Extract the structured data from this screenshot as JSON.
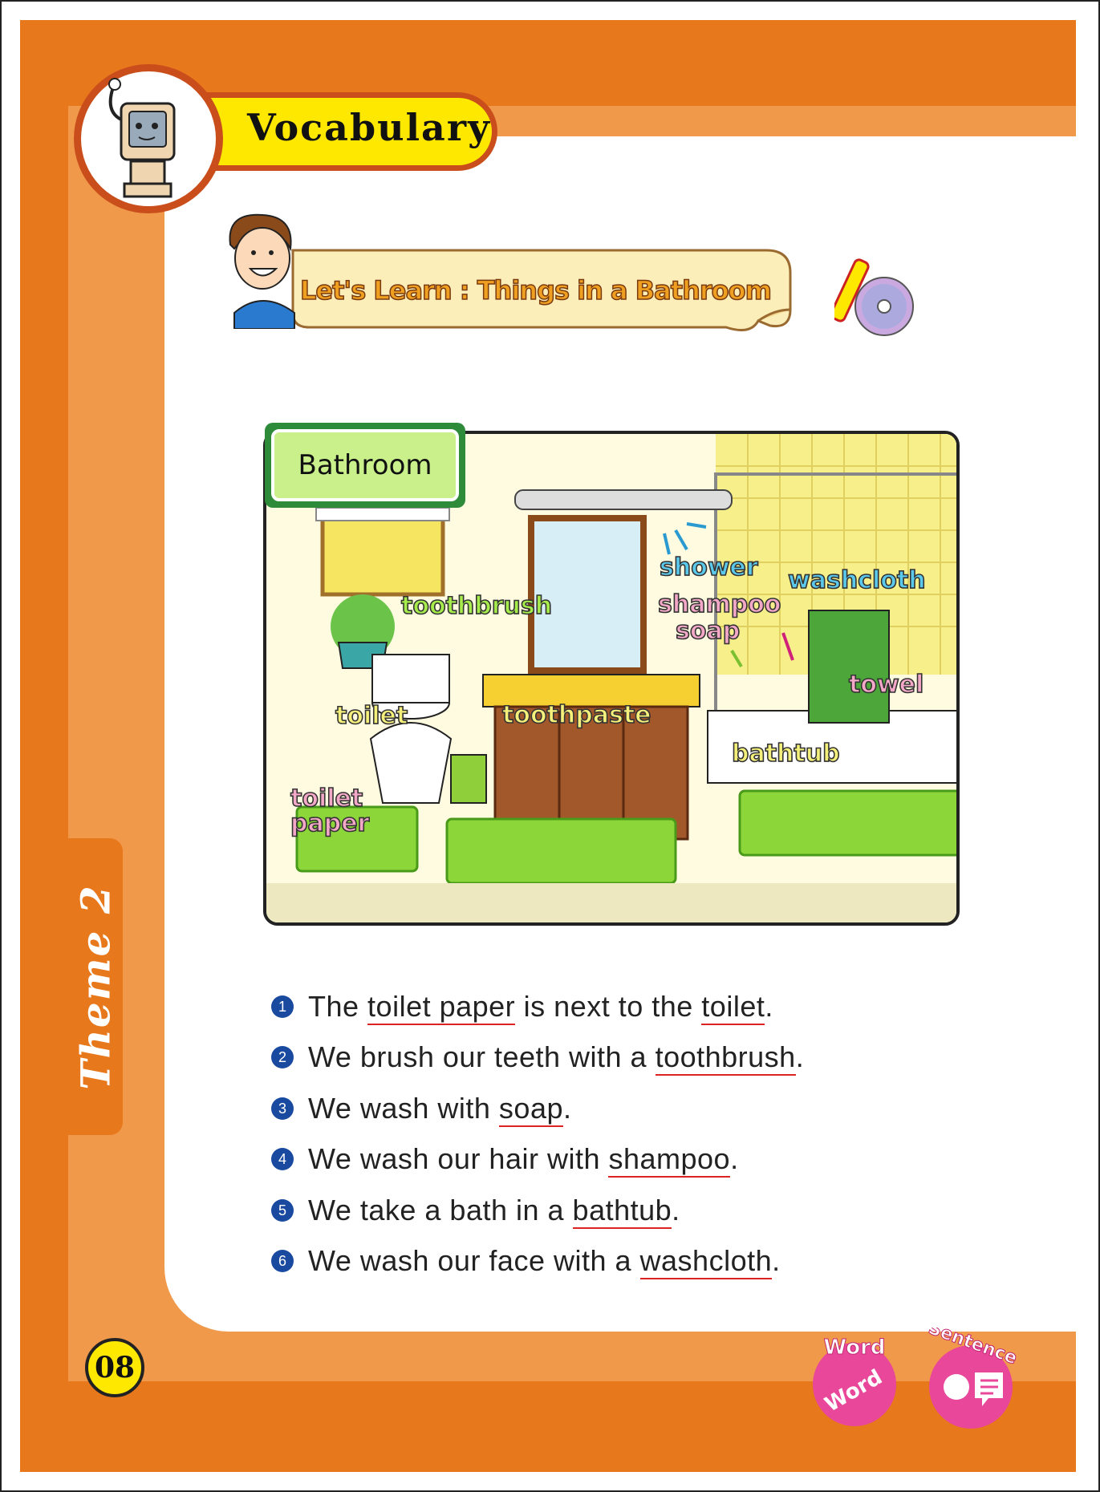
{
  "header": {
    "section_title": "Vocabulary",
    "lesson_title": "Let's Learn : Things in a Bathroom"
  },
  "side_tab": {
    "label": "Theme 2"
  },
  "scene": {
    "title": "Bathroom",
    "labels": {
      "toothbrush": "toothbrush",
      "shower": "shower",
      "washcloth": "washcloth",
      "shampoo": "shampoo",
      "soap": "soap",
      "toilet": "toilet",
      "toothpaste": "toothpaste",
      "towel": "towel",
      "bathtub": "bathtub",
      "toilet_paper_1": "toilet",
      "toilet_paper_2": "paper"
    }
  },
  "sentences": [
    {
      "num": "1",
      "a": "The ",
      "u1": "toilet paper",
      "b": " is next to the ",
      "u2": "toilet",
      "c": "."
    },
    {
      "num": "2",
      "a": "We brush our teeth with a ",
      "u1": "toothbrush",
      "b": "."
    },
    {
      "num": "3",
      "a": "We wash with ",
      "u1": "soap",
      "b": "."
    },
    {
      "num": "4",
      "a": "We wash our hair with ",
      "u1": "shampoo",
      "b": "."
    },
    {
      "num": "5",
      "a": "We take a bath in a ",
      "u1": "bathtub",
      "b": "."
    },
    {
      "num": "6",
      "a": "We wash our face with a ",
      "u1": "washcloth",
      "b": "."
    }
  ],
  "footer": {
    "page_number": "08",
    "badge_word_top": "Word",
    "badge_word_bottom": "Word",
    "badge_sentence": "Sentence"
  }
}
